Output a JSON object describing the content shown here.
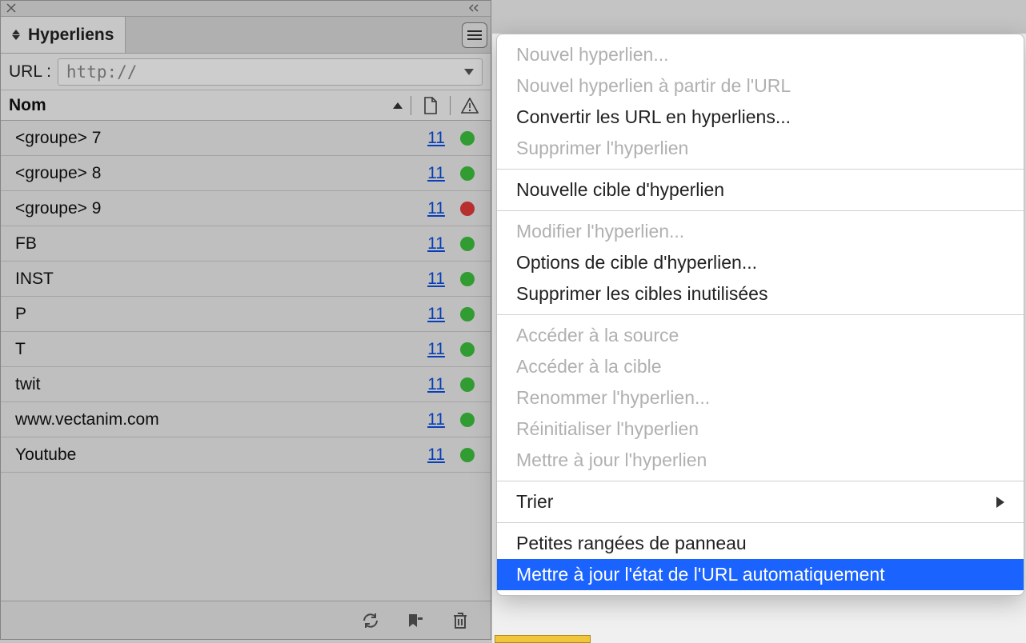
{
  "panel": {
    "tab_title": "Hyperliens",
    "url_label": "URL :",
    "url_placeholder": "http://",
    "headers": {
      "name": "Nom"
    },
    "rows": [
      {
        "name": "<groupe> 7",
        "count": "11",
        "status": "green"
      },
      {
        "name": "<groupe> 8",
        "count": "11",
        "status": "green"
      },
      {
        "name": "<groupe> 9",
        "count": "11",
        "status": "red"
      },
      {
        "name": "FB",
        "count": "11",
        "status": "green"
      },
      {
        "name": "INST",
        "count": "11",
        "status": "green"
      },
      {
        "name": "P",
        "count": "11",
        "status": "green"
      },
      {
        "name": "T",
        "count": "11",
        "status": "green"
      },
      {
        "name": "twit",
        "count": "11",
        "status": "green"
      },
      {
        "name": "www.vectanim.com",
        "count": "11",
        "status": "green"
      },
      {
        "name": "Youtube",
        "count": "11",
        "status": "green"
      }
    ]
  },
  "menu": {
    "items": [
      {
        "label": "Nouvel hyperlien...",
        "enabled": false
      },
      {
        "label": "Nouvel hyperlien à partir de l'URL",
        "enabled": false
      },
      {
        "label": "Convertir les URL en hyperliens...",
        "enabled": true
      },
      {
        "label": "Supprimer l'hyperlien",
        "enabled": false
      },
      {
        "sep": true
      },
      {
        "label": "Nouvelle cible d'hyperlien",
        "enabled": true
      },
      {
        "sep": true
      },
      {
        "label": "Modifier l'hyperlien...",
        "enabled": false
      },
      {
        "label": "Options de cible d'hyperlien...",
        "enabled": true
      },
      {
        "label": "Supprimer les cibles inutilisées",
        "enabled": true
      },
      {
        "sep": true
      },
      {
        "label": "Accéder à la source",
        "enabled": false
      },
      {
        "label": "Accéder à la cible",
        "enabled": false
      },
      {
        "label": "Renommer l'hyperlien...",
        "enabled": false
      },
      {
        "label": "Réinitialiser l'hyperlien",
        "enabled": false
      },
      {
        "label": "Mettre à jour l'hyperlien",
        "enabled": false
      },
      {
        "sep": true
      },
      {
        "label": "Trier",
        "enabled": true,
        "submenu": true
      },
      {
        "sep": true
      },
      {
        "label": "Petites rangées de panneau",
        "enabled": true
      },
      {
        "label": "Mettre à jour l'état de l'URL automatiquement",
        "enabled": true,
        "highlight": true
      }
    ]
  }
}
